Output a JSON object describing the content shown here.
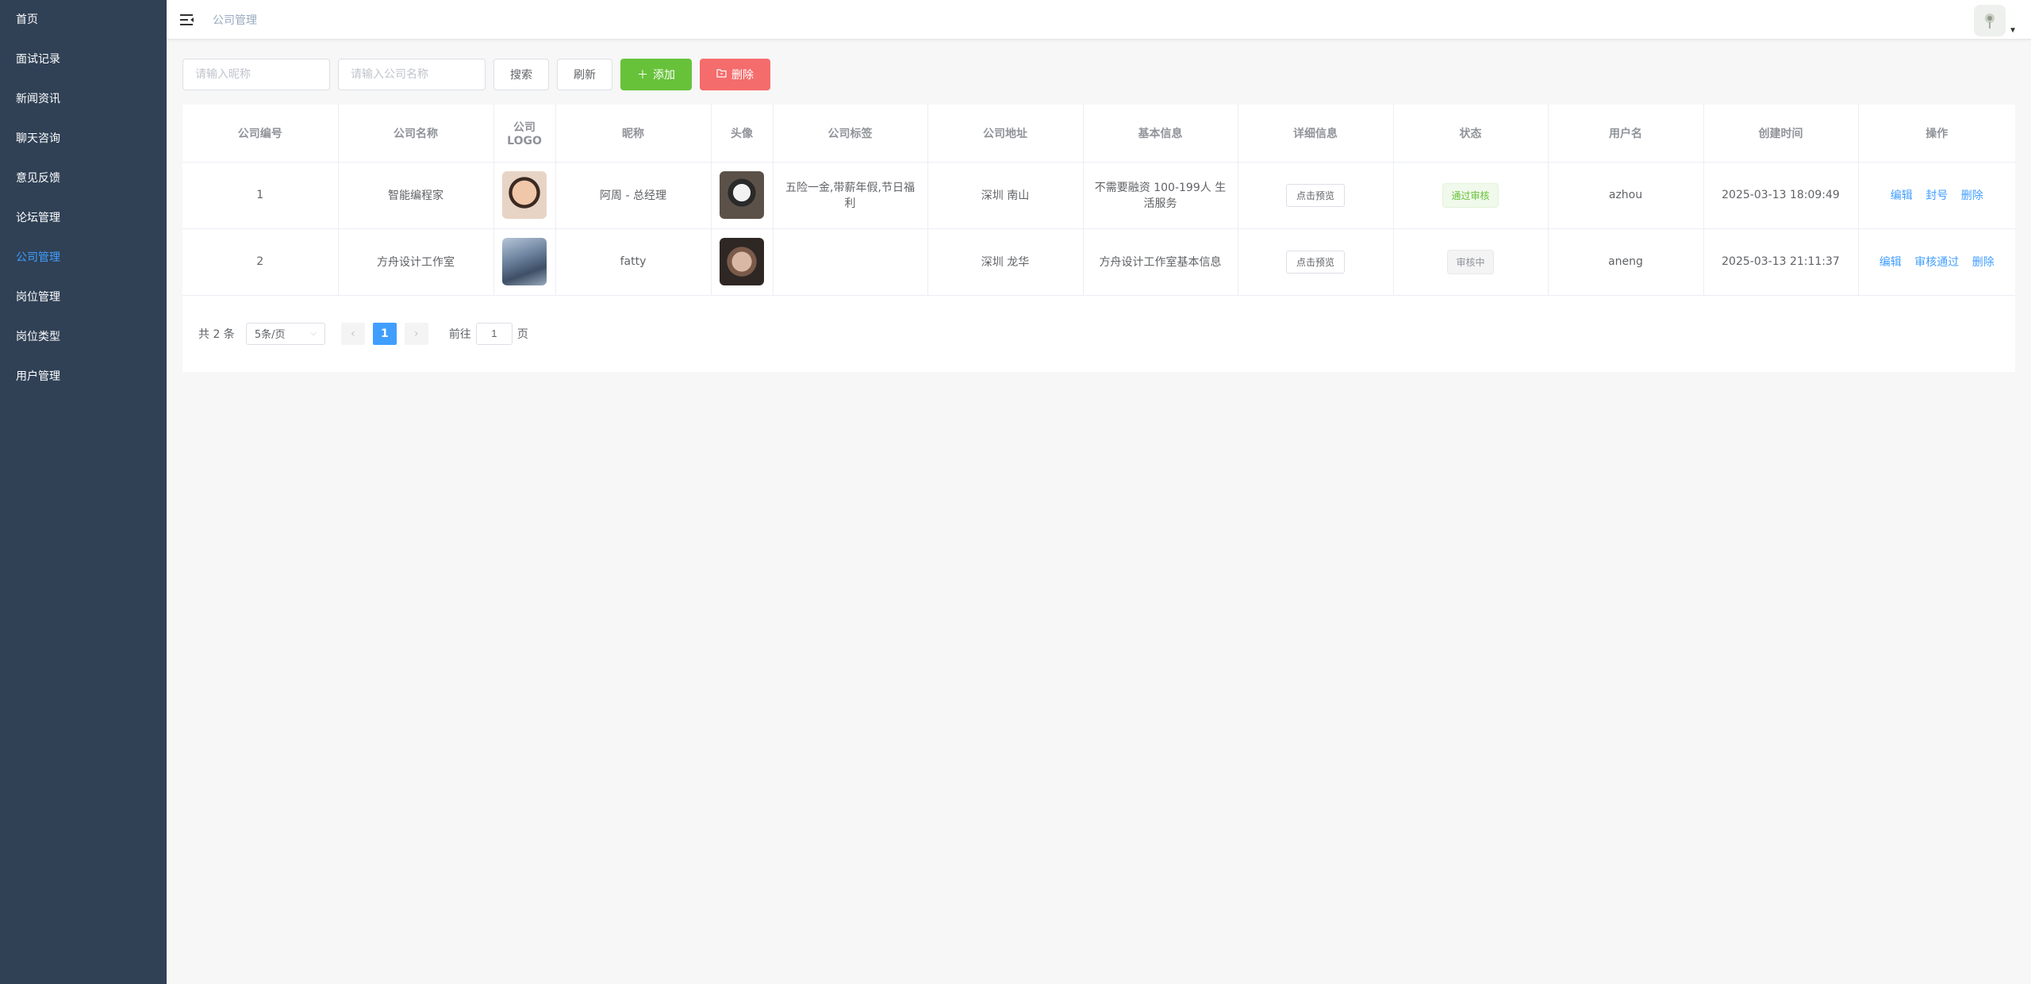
{
  "sidebar": {
    "items": [
      {
        "label": "首页"
      },
      {
        "label": "面试记录"
      },
      {
        "label": "新闻资讯"
      },
      {
        "label": "聊天咨询"
      },
      {
        "label": "意见反馈"
      },
      {
        "label": "论坛管理"
      },
      {
        "label": "公司管理"
      },
      {
        "label": "岗位管理"
      },
      {
        "label": "岗位类型"
      },
      {
        "label": "用户管理"
      }
    ],
    "active_index": 6
  },
  "navbar": {
    "breadcrumb": "公司管理"
  },
  "toolbar": {
    "nickname_placeholder": "请输入昵称",
    "company_placeholder": "请输入公司名称",
    "search_label": "搜索",
    "refresh_label": "刷新",
    "add_label": "添加",
    "delete_label": "删除"
  },
  "table": {
    "headers": [
      "公司编号",
      "公司名称",
      "公司LOGO",
      "昵称",
      "头像",
      "公司标签",
      "公司地址",
      "基本信息",
      "详细信息",
      "状态",
      "用户名",
      "创建时间",
      "操作"
    ],
    "rows": [
      {
        "id": "1",
        "name": "智能编程家",
        "nickname": "阿周 - 总经理",
        "tags": "五险一金,带薪年假,节日福利",
        "address": "深圳 南山",
        "basic_info": "不需要融资 100-199人 生活服务",
        "detail_btn": "点击预览",
        "status": "通过审核",
        "username": "azhou",
        "created": "2025-03-13 18:09:49",
        "actions": [
          "编辑",
          "封号",
          "删除"
        ]
      },
      {
        "id": "2",
        "name": "方舟设计工作室",
        "nickname": "fatty",
        "tags": "",
        "address": "深圳 龙华",
        "basic_info": "方舟设计工作室基本信息",
        "detail_btn": "点击预览",
        "status": "审核中",
        "username": "aneng",
        "created": "2025-03-13 21:11:37",
        "actions": [
          "编辑",
          "审核通过",
          "删除"
        ]
      }
    ]
  },
  "pagination": {
    "total": "共 2 条",
    "page_size": "5条/页",
    "current_page": "1",
    "goto_prefix": "前往",
    "goto_value": "1",
    "goto_suffix": "页"
  },
  "colors": {
    "sidebar_bg": "#304156",
    "primary": "#409eff",
    "success": "#67c23a",
    "danger": "#f56c6c"
  }
}
